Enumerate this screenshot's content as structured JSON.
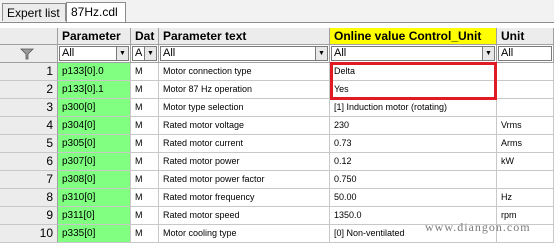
{
  "tabs": [
    {
      "label": "Expert list"
    },
    {
      "label": "87Hz.cdl"
    }
  ],
  "columns": {
    "index": "",
    "parameter": "Parameter",
    "data": "Dat",
    "parameter_text": "Parameter text",
    "online_value": "Online value Control_Unit",
    "unit": "Unit"
  },
  "filters": {
    "parameter": "All",
    "data": "A",
    "parameter_text": "All",
    "online_value": "All",
    "unit": "All"
  },
  "rows": [
    {
      "index": "1",
      "parameter": "p133[0].0",
      "data": "M",
      "text": "Motor connection type",
      "value": "Delta",
      "unit": ""
    },
    {
      "index": "2",
      "parameter": "p133[0].1",
      "data": "M",
      "text": "Motor 87 Hz operation",
      "value": "Yes",
      "unit": ""
    },
    {
      "index": "3",
      "parameter": "p300[0]",
      "data": "M",
      "text": "Motor type selection",
      "value": "[1] Induction motor (rotating)",
      "unit": ""
    },
    {
      "index": "4",
      "parameter": "p304[0]",
      "data": "M",
      "text": "Rated motor voltage",
      "value": "230",
      "unit": "Vrms"
    },
    {
      "index": "5",
      "parameter": "p305[0]",
      "data": "M",
      "text": "Rated motor current",
      "value": "0.73",
      "unit": "Arms"
    },
    {
      "index": "6",
      "parameter": "p307[0]",
      "data": "M",
      "text": "Rated motor power",
      "value": "0.12",
      "unit": "kW"
    },
    {
      "index": "7",
      "parameter": "p308[0]",
      "data": "M",
      "text": "Rated motor power factor",
      "value": "0.750",
      "unit": ""
    },
    {
      "index": "8",
      "parameter": "p310[0]",
      "data": "M",
      "text": "Rated motor frequency",
      "value": "50.00",
      "unit": "Hz"
    },
    {
      "index": "9",
      "parameter": "p311[0]",
      "data": "M",
      "text": "Rated motor speed",
      "value": "1350.0",
      "unit": "rpm"
    },
    {
      "index": "10",
      "parameter": "p335[0]",
      "data": "M",
      "text": "Motor cooling type",
      "value": "[0] Non-ventilated",
      "unit": ""
    }
  ],
  "watermark": "www.diangon.com",
  "colors": {
    "parameter_cell": "#80ff80",
    "online_header": "#ffff00",
    "highlight_box": "#e01b24"
  },
  "icons": {
    "filter": "funnel-icon",
    "dropdown": "chevron-down-icon"
  }
}
